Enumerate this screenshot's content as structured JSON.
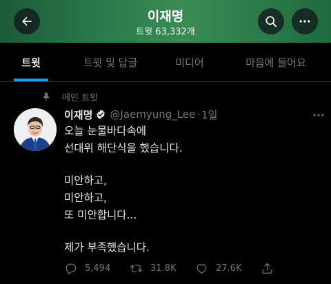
{
  "header": {
    "name": "이재명",
    "tweet_count": "트윗 63,332개"
  },
  "tabs": [
    {
      "label": "트윗",
      "active": true
    },
    {
      "label": "트윗 및 답글",
      "active": false
    },
    {
      "label": "미디어",
      "active": false
    },
    {
      "label": "마음에 들어요",
      "active": false
    }
  ],
  "pinned_label": "메인 트윗",
  "tweet": {
    "author_name": "이재명",
    "handle": "@Jaemyung_Lee",
    "separator": "·",
    "time": "1일",
    "lines": [
      "오늘 눈물바다속에",
      "선대위 해단식을 했습니다.",
      "",
      "미안하고,",
      "미안하고,",
      "또 미안합니다...",
      "",
      "제가 부족했습니다."
    ],
    "stats": {
      "replies": "5,494",
      "retweets": "31.8K",
      "likes": "27.6K"
    }
  },
  "colors": {
    "accent": "#1d9bf0",
    "background": "#000000",
    "muted_text": "#71767b",
    "primary_text": "#e7e9ea",
    "header_green": "#2f7d4b"
  },
  "icons": [
    "back-arrow-icon",
    "search-icon",
    "more-icon",
    "pin-icon",
    "verified-badge-icon",
    "reply-icon",
    "retweet-icon",
    "like-icon",
    "share-icon"
  ]
}
